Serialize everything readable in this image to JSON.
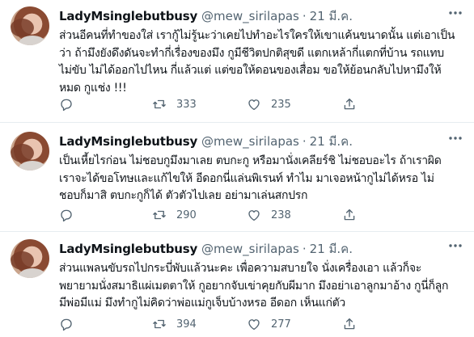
{
  "tweets": [
    {
      "name": "LadyMsinglebutbusy",
      "handle": "@mew_sirilapas",
      "dot": "·",
      "date": "21 มี.ค.",
      "lines": [
        "ส่วนอีคนที่ทำของใส่ เรากู้ไม่รู้นะว่าเคยไปทำอะไรใครให้เขาแค้นขนาดนั้น แต่เอาเป็น",
        "ว่า ถ้ามึงยังดึงดันจะทำกี่เรื่องของมึง กูมีชีวิตปกติสุขดี แตกเหล้ากี่แตกที่บ้าน รถแทบ",
        "ไม่ขับ ไม่ได้ออกไปไหน กี่แล้วแต่ แต่ขอให้ดอนของเสื่อม ขอให้ย้อนกลับไปหามึงให้",
        "หมด กูแช่ง !!!"
      ],
      "replies": "",
      "retweets": "333",
      "likes": "235"
    },
    {
      "name": "LadyMsinglebutbusy",
      "handle": "@mew_sirilapas",
      "dot": "·",
      "date": "21 มี.ค.",
      "lines": [
        "เป็นเหี้ยไรก่อน ไม่ชอบกูมึงมาเลย ตบกะกู หรือมานั่งเคลียร์ชิ ไม่ชอบอะไร ถ้าเราผิด",
        "เราจะได้ขอโทษและแก้ไขให้ อีดอกนี่แล่นพิเรนท์ ทำไม มาเจอหน้ากูไม่ได้หรอ ไม่",
        "ชอบก็มาสิ ตบกะกูก็ได้ ตัวตัวไปเลย อย่ามาเล่นสกปรก"
      ],
      "replies": "",
      "retweets": "290",
      "likes": "238"
    },
    {
      "name": "LadyMsinglebutbusy",
      "handle": "@mew_sirilapas",
      "dot": "·",
      "date": "21 มี.ค.",
      "lines": [
        "ส่วนแพลนขับรถไปกระบี่พับแล้วนะคะ เพื่อความสบายใจ นั่งเครื่องเอา แล้วก็จะ",
        "พยายามนั่งสมาธิแผ่เมตตาให้ กูอยากจับเข่าคุยกับผีมาก มึงอย่าเอาลูกมาอ้าง กูนี่ก็ลูก",
        "มีพ่อมีแม่ มึงทำกูไม่คิดว่าพ่อแม่กูเจ็บบ้างหรอ อีดอก เห็นแก่ตัว"
      ],
      "replies": "",
      "retweets": "394",
      "likes": "277"
    }
  ],
  "icons": {
    "reply": "reply-icon",
    "retweet": "retweet-icon",
    "like": "like-icon",
    "share": "share-icon",
    "more": "more-icon"
  },
  "colors": {
    "text": "#0f1419",
    "secondary": "#536471",
    "separator": "#e6ecf0"
  }
}
